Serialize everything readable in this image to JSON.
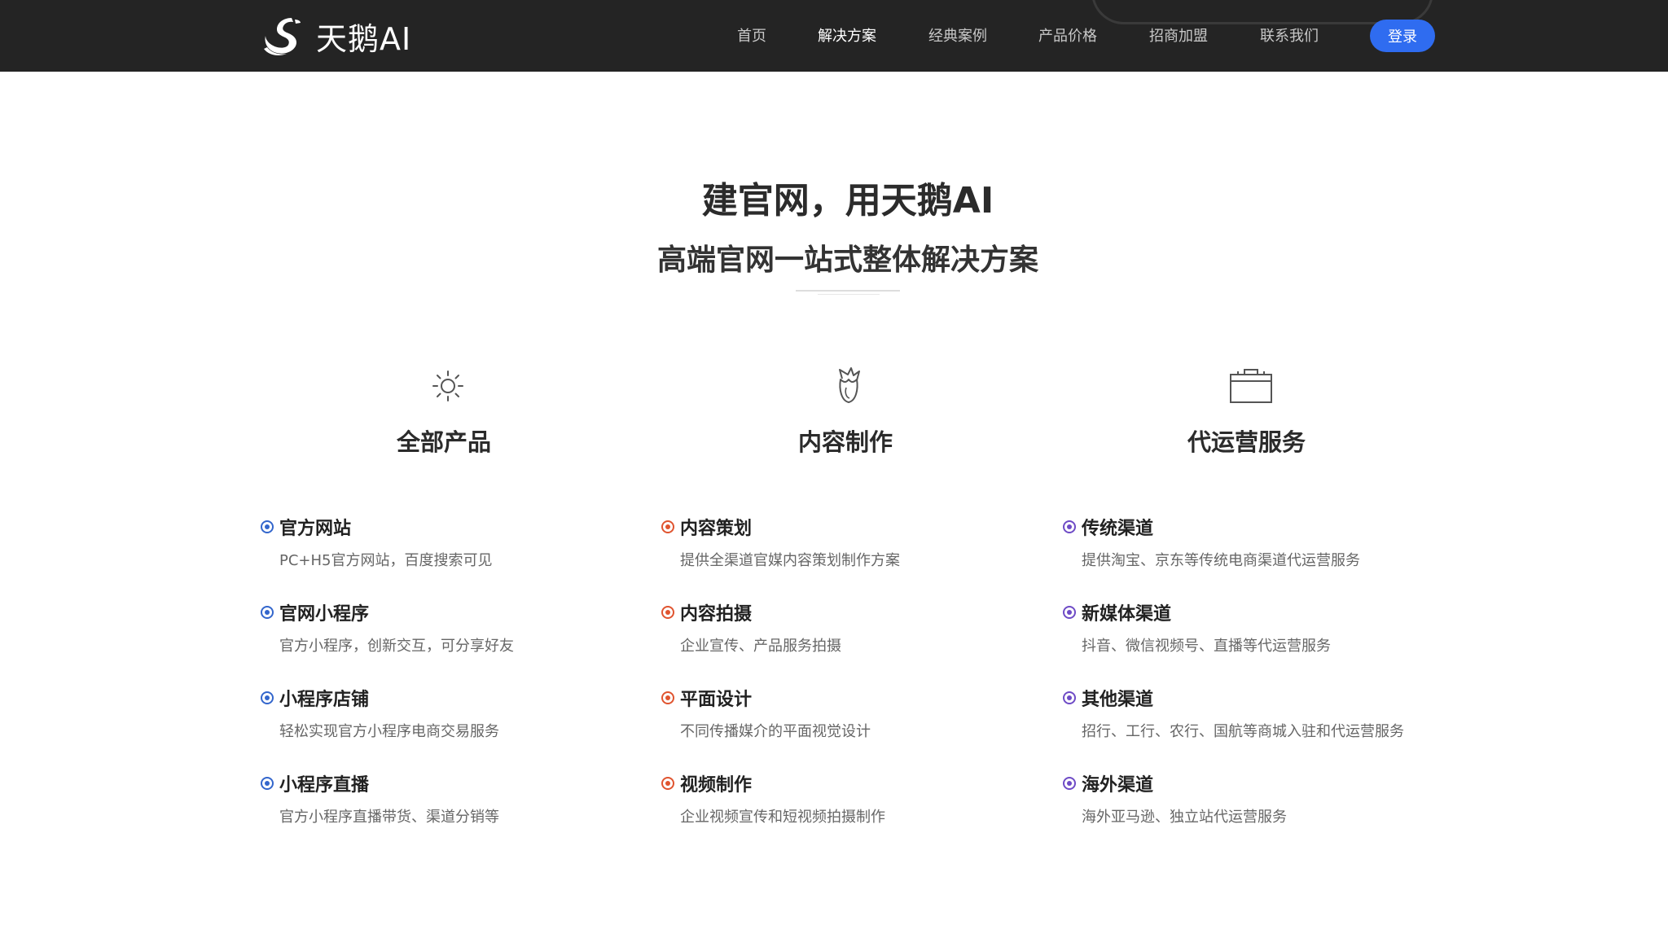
{
  "brand": {
    "name": "天鹅AI",
    "icon": "swan-logo-icon"
  },
  "nav": {
    "items": [
      {
        "label": "首页",
        "active": false
      },
      {
        "label": "解决方案",
        "active": true
      },
      {
        "label": "经典案例",
        "active": false
      },
      {
        "label": "产品价格",
        "active": false
      },
      {
        "label": "招商加盟",
        "active": false
      },
      {
        "label": "联系我们",
        "active": false
      }
    ],
    "login_label": "登录",
    "login_color": "#2f6cf0"
  },
  "hero": {
    "title": "建官网，用天鹅AI",
    "subtitle": "高端官网一站式整体解决方案"
  },
  "columns": [
    {
      "icon": "sun-icon",
      "title": "全部产品",
      "dot_color": "#3366cc",
      "items": [
        {
          "title": "官方网站",
          "desc": "PC+H5官方网站，百度搜索可见"
        },
        {
          "title": "官网小程序",
          "desc": "官方小程序，创新交互，可分享好友"
        },
        {
          "title": "小程序店铺",
          "desc": "轻松实现官方小程序电商交易服务"
        },
        {
          "title": "小程序直播",
          "desc": "官方小程序直播带货、渠道分销等"
        }
      ]
    },
    {
      "icon": "flower-icon",
      "title": "内容制作",
      "dot_color": "#e0542f",
      "items": [
        {
          "title": "内容策划",
          "desc": "提供全渠道官媒内容策划制作方案"
        },
        {
          "title": "内容拍摄",
          "desc": "企业宣传、产品服务拍摄"
        },
        {
          "title": "平面设计",
          "desc": "不同传播媒介的平面视觉设计"
        },
        {
          "title": "视频制作",
          "desc": "企业视频宣传和短视频拍摄制作"
        }
      ]
    },
    {
      "icon": "briefcase-icon",
      "title": "代运营服务",
      "dot_color": "#6e4bc6",
      "items": [
        {
          "title": "传统渠道",
          "desc": "提供淘宝、京东等传统电商渠道代运营服务"
        },
        {
          "title": "新媒体渠道",
          "desc": "抖音、微信视频号、直播等代运营服务"
        },
        {
          "title": "其他渠道",
          "desc": "招行、工行、农行、国航等商城入驻和代运营服务"
        },
        {
          "title": "海外渠道",
          "desc": "海外亚马逊、独立站代运营服务"
        }
      ]
    }
  ]
}
